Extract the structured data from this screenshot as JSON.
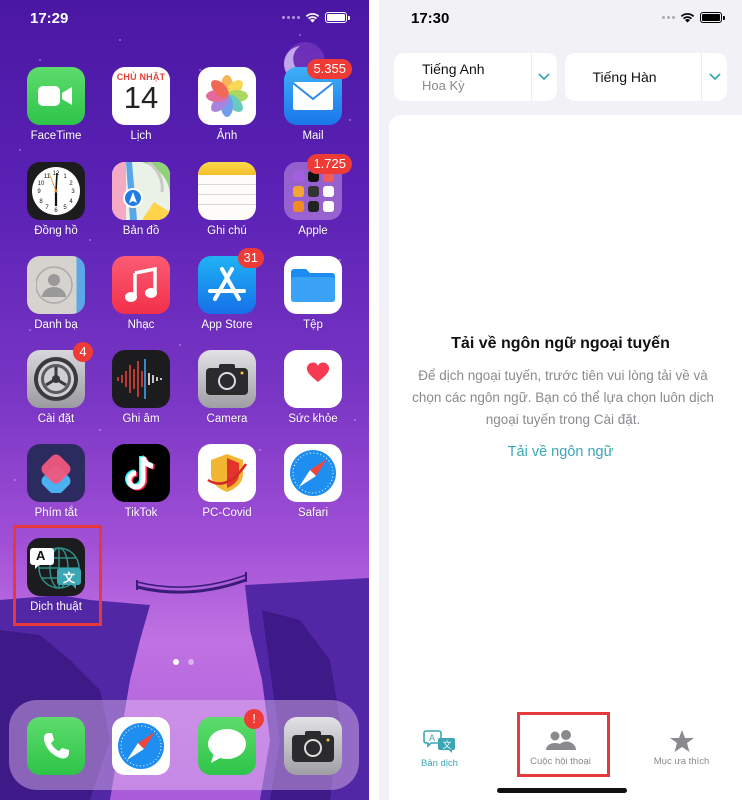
{
  "home_screen": {
    "status_bar": {
      "time": "17:29"
    },
    "apps": [
      {
        "name": "FaceTime",
        "icon": "facetime-icon",
        "badge": null
      },
      {
        "name": "Lịch",
        "icon": "calendar-icon",
        "badge": null,
        "calendar_day": "CHỦ NHẬT",
        "calendar_date": "14"
      },
      {
        "name": "Ảnh",
        "icon": "photos-icon",
        "badge": null
      },
      {
        "name": "Mail",
        "icon": "mail-icon",
        "badge": "5.355"
      },
      {
        "name": "Đồng hồ",
        "icon": "clock-icon",
        "badge": null
      },
      {
        "name": "Bản đồ",
        "icon": "maps-icon",
        "badge": null
      },
      {
        "name": "Ghi chú",
        "icon": "notes-icon",
        "badge": null
      },
      {
        "name": "Apple",
        "icon": "apple-folder-icon",
        "badge": "1.725"
      },
      {
        "name": "Danh bạ",
        "icon": "contacts-icon",
        "badge": null
      },
      {
        "name": "Nhạc",
        "icon": "music-icon",
        "badge": null
      },
      {
        "name": "App Store",
        "icon": "app-store-icon",
        "badge": "31"
      },
      {
        "name": "Tệp",
        "icon": "files-icon",
        "badge": null
      },
      {
        "name": "Cài đặt",
        "icon": "settings-icon",
        "badge": "4"
      },
      {
        "name": "Ghi âm",
        "icon": "voice-memos-icon",
        "badge": null
      },
      {
        "name": "Camera",
        "icon": "camera-icon",
        "badge": null
      },
      {
        "name": "Sức khỏe",
        "icon": "health-icon",
        "badge": null
      },
      {
        "name": "Phím tắt",
        "icon": "shortcuts-icon",
        "badge": null
      },
      {
        "name": "TikTok",
        "icon": "tiktok-icon",
        "badge": null
      },
      {
        "name": "PC-Covid",
        "icon": "pc-covid-icon",
        "badge": null
      },
      {
        "name": "Safari",
        "icon": "safari-icon",
        "badge": null
      },
      {
        "name": "Dịch thuật",
        "icon": "translate-icon",
        "badge": null
      }
    ],
    "translate_icon_letters": {
      "latin": "A",
      "cjk": "文"
    },
    "page_indicator": {
      "pages": 2,
      "current": 1
    },
    "dock": [
      {
        "name": "Phone",
        "icon": "phone-icon",
        "badge": null
      },
      {
        "name": "Safari",
        "icon": "safari-icon",
        "badge": null
      },
      {
        "name": "Messages",
        "icon": "messages-icon",
        "badge": "!"
      },
      {
        "name": "Camera",
        "icon": "camera-icon",
        "badge": null
      }
    ],
    "highlighted_app": "Dịch thuật"
  },
  "translate_app": {
    "status_bar": {
      "time": "17:30"
    },
    "source_language": {
      "name": "Tiếng Anh",
      "region": "Hoa Kỳ"
    },
    "target_language": {
      "name": "Tiếng Hàn"
    },
    "empty_state": {
      "title": "Tải về ngôn ngữ ngoại tuyến",
      "description": "Để dịch ngoại tuyến, trước tiên vui lòng tải về và chọn các ngôn ngữ. Bạn có thể lựa chọn luôn dịch ngoại tuyến trong Cài đặt.",
      "link": "Tải về ngôn ngữ"
    },
    "tabs": [
      {
        "label": "Bản dịch",
        "icon": "translate-tab-icon",
        "active": true
      },
      {
        "label": "Cuộc hội thoại",
        "icon": "conversation-icon",
        "active": false
      },
      {
        "label": "Mục ưa thích",
        "icon": "star-icon",
        "active": false
      }
    ],
    "highlighted_tab": "Cuộc hội thoại"
  },
  "colors": {
    "accent_teal": "#3ba7b5",
    "badge_red": "#ef3b35",
    "highlight_red": "#e6393b",
    "wallpaper_top": "#4a17a3",
    "wallpaper_mid": "#a150d6"
  }
}
